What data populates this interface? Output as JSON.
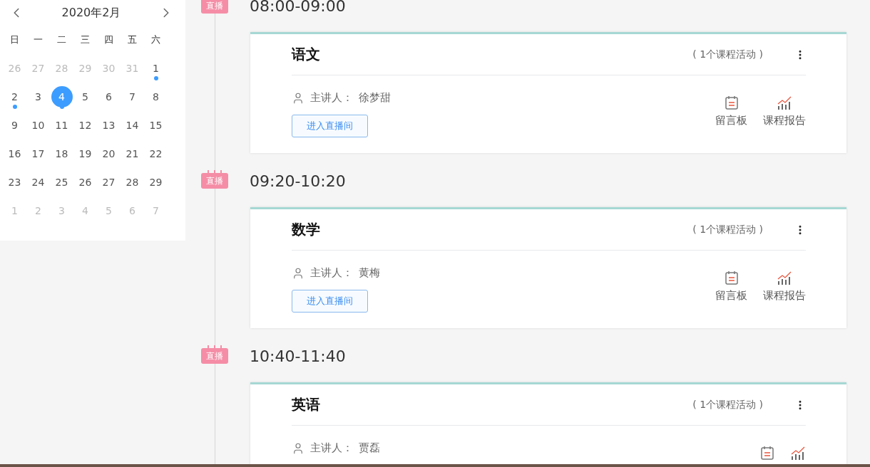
{
  "calendar": {
    "title": "2020年2月",
    "weekdays": [
      "日",
      "一",
      "二",
      "三",
      "四",
      "五",
      "六"
    ],
    "weeks": [
      [
        {
          "day": "26",
          "outside": true,
          "selected": false,
          "dot": false
        },
        {
          "day": "27",
          "outside": true,
          "selected": false,
          "dot": false
        },
        {
          "day": "28",
          "outside": true,
          "selected": false,
          "dot": false
        },
        {
          "day": "29",
          "outside": true,
          "selected": false,
          "dot": false
        },
        {
          "day": "30",
          "outside": true,
          "selected": false,
          "dot": false
        },
        {
          "day": "31",
          "outside": true,
          "selected": false,
          "dot": false
        },
        {
          "day": "1",
          "outside": false,
          "selected": false,
          "dot": true
        }
      ],
      [
        {
          "day": "2",
          "outside": false,
          "selected": false,
          "dot": true
        },
        {
          "day": "3",
          "outside": false,
          "selected": false,
          "dot": false
        },
        {
          "day": "4",
          "outside": false,
          "selected": true,
          "dot": true
        },
        {
          "day": "5",
          "outside": false,
          "selected": false,
          "dot": false
        },
        {
          "day": "6",
          "outside": false,
          "selected": false,
          "dot": false
        },
        {
          "day": "7",
          "outside": false,
          "selected": false,
          "dot": false
        },
        {
          "day": "8",
          "outside": false,
          "selected": false,
          "dot": false
        }
      ],
      [
        {
          "day": "9",
          "outside": false,
          "selected": false,
          "dot": false
        },
        {
          "day": "10",
          "outside": false,
          "selected": false,
          "dot": false
        },
        {
          "day": "11",
          "outside": false,
          "selected": false,
          "dot": false
        },
        {
          "day": "12",
          "outside": false,
          "selected": false,
          "dot": false
        },
        {
          "day": "13",
          "outside": false,
          "selected": false,
          "dot": false
        },
        {
          "day": "14",
          "outside": false,
          "selected": false,
          "dot": false
        },
        {
          "day": "15",
          "outside": false,
          "selected": false,
          "dot": false
        }
      ],
      [
        {
          "day": "16",
          "outside": false,
          "selected": false,
          "dot": false
        },
        {
          "day": "17",
          "outside": false,
          "selected": false,
          "dot": false
        },
        {
          "day": "18",
          "outside": false,
          "selected": false,
          "dot": false
        },
        {
          "day": "19",
          "outside": false,
          "selected": false,
          "dot": false
        },
        {
          "day": "20",
          "outside": false,
          "selected": false,
          "dot": false
        },
        {
          "day": "21",
          "outside": false,
          "selected": false,
          "dot": false
        },
        {
          "day": "22",
          "outside": false,
          "selected": false,
          "dot": false
        }
      ],
      [
        {
          "day": "23",
          "outside": false,
          "selected": false,
          "dot": false
        },
        {
          "day": "24",
          "outside": false,
          "selected": false,
          "dot": false
        },
        {
          "day": "25",
          "outside": false,
          "selected": false,
          "dot": false
        },
        {
          "day": "26",
          "outside": false,
          "selected": false,
          "dot": false
        },
        {
          "day": "27",
          "outside": false,
          "selected": false,
          "dot": false
        },
        {
          "day": "28",
          "outside": false,
          "selected": false,
          "dot": false
        },
        {
          "day": "29",
          "outside": false,
          "selected": false,
          "dot": false
        }
      ],
      [
        {
          "day": "1",
          "outside": true,
          "selected": false,
          "dot": false
        },
        {
          "day": "2",
          "outside": true,
          "selected": false,
          "dot": false
        },
        {
          "day": "3",
          "outside": true,
          "selected": false,
          "dot": false
        },
        {
          "day": "4",
          "outside": true,
          "selected": false,
          "dot": false
        },
        {
          "day": "5",
          "outside": true,
          "selected": false,
          "dot": false
        },
        {
          "day": "6",
          "outside": true,
          "selected": false,
          "dot": false
        },
        {
          "day": "7",
          "outside": true,
          "selected": false,
          "dot": false
        }
      ]
    ]
  },
  "sessions": [
    {
      "tag": "直播",
      "time": "08:00-09:00",
      "subject": "语文",
      "activities": "( 1个课程活动 )",
      "presenter_label": "主讲人：",
      "presenter": "徐梦甜",
      "enter_button": "进入直播间",
      "actions": [
        {
          "kind": "board",
          "label": "留言板"
        },
        {
          "kind": "report",
          "label": "课程报告"
        }
      ]
    },
    {
      "tag": "直播",
      "time": "09:20-10:20",
      "subject": "数学",
      "activities": "( 1个课程活动 )",
      "presenter_label": "主讲人：",
      "presenter": "黄梅",
      "enter_button": "进入直播间",
      "actions": [
        {
          "kind": "board",
          "label": "留言板"
        },
        {
          "kind": "report",
          "label": "课程报告"
        }
      ]
    },
    {
      "tag": "直播",
      "time": "10:40-11:40",
      "subject": "英语",
      "activities": "( 1个课程活动 )",
      "presenter_label": "主讲人：",
      "presenter": "贾磊",
      "actions": [
        {
          "kind": "board"
        },
        {
          "kind": "report"
        }
      ]
    }
  ]
}
